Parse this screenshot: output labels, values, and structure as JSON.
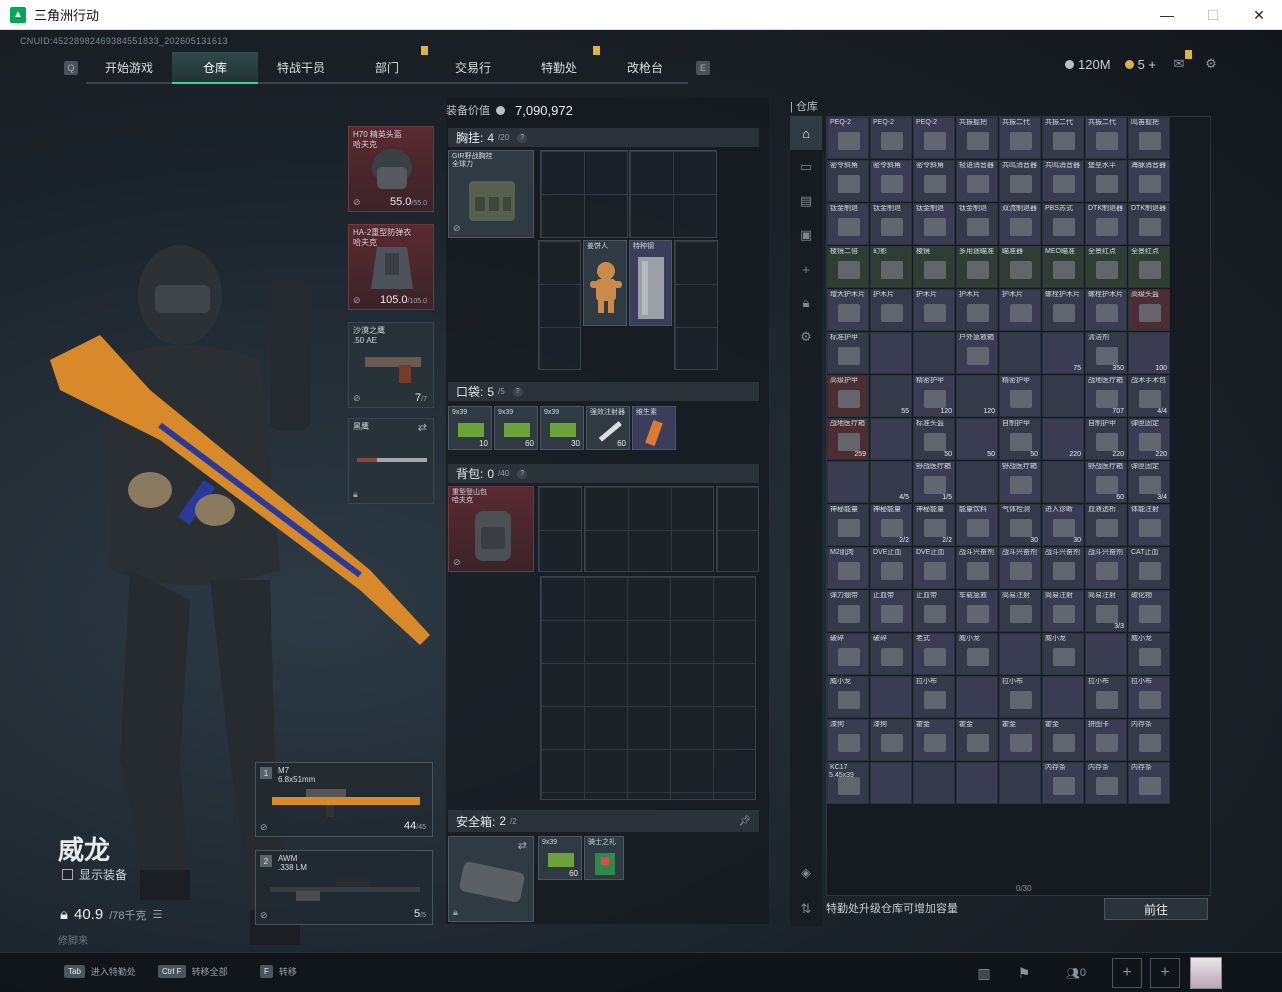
{
  "window": {
    "title": "三角洲行动"
  },
  "uid": "CNUID:4522898246938455183​3_20260513161​3",
  "nav": {
    "tabs": [
      {
        "label": "开始游戏",
        "notif": false
      },
      {
        "label": "仓库",
        "notif": false,
        "active": true
      },
      {
        "label": "特战干员",
        "notif": false
      },
      {
        "label": "部门",
        "notif": true
      },
      {
        "label": "交易行",
        "notif": false
      },
      {
        "label": "特勤处",
        "notif": true
      },
      {
        "label": "改枪台",
        "notif": false
      }
    ],
    "left_key": "Q",
    "right_key": "E"
  },
  "currency": {
    "money": "120M",
    "coins": "5 +"
  },
  "character": {
    "name": "威龙",
    "show_equipment": "显示装备",
    "weight": "40.9",
    "weight_max": "/78千克",
    "repair_hint": "修脚来"
  },
  "equipment": {
    "helmet": {
      "name": "H70 精英头盔",
      "sub": "哈夫克",
      "durability": "55.0",
      "max": "/55.0"
    },
    "armor": {
      "name": "HA-2重型防弹衣",
      "sub": "哈夫克",
      "durability": "105.0",
      "max": "/105.0"
    },
    "pistol": {
      "name": "沙漠之鹰",
      "sub": ".50 AE",
      "ammo": "7",
      "max": "/7"
    },
    "melee": {
      "name": "黑鹰"
    }
  },
  "weapons": [
    {
      "num": "1",
      "name": "M7",
      "caliber": "6.8x51mm",
      "ammo": "44",
      "max": "/45"
    },
    {
      "num": "2",
      "name": "AWM",
      "caliber": ".338 LM",
      "ammo": "5",
      "max": "/5"
    }
  ],
  "loadout": {
    "value_label": "装备价值",
    "value": "7,090,972",
    "chest": {
      "label": "胸挂:",
      "count": "4",
      "max": "/20",
      "item": "GIR野战胸挂",
      "item_sub": "全球力",
      "items": [
        {
          "name": "姜饼人"
        },
        {
          "name": "特种钢"
        }
      ]
    },
    "pockets": {
      "label": "口袋:",
      "count": "5",
      "max": "/5",
      "items": [
        {
          "name": "9x39",
          "count": "10"
        },
        {
          "name": "9x39",
          "count": "60"
        },
        {
          "name": "9x39",
          "count": "30"
        },
        {
          "name": "强效注射器",
          "count": "60"
        },
        {
          "name": "维生素"
        }
      ]
    },
    "backpack": {
      "label": "背包:",
      "count": "0",
      "max": "/40",
      "item": "重型登山包",
      "item_sub": "哈夫克"
    },
    "safe": {
      "label": "安全箱:",
      "count": "2",
      "max": "/2",
      "items": [
        {
          "name": "9x39",
          "count": "60"
        },
        {
          "name": "骑士之礼"
        }
      ]
    }
  },
  "warehouse": {
    "label": "仓库",
    "capacity": "0/30",
    "footer": "特勤处升级仓库可增加容量",
    "go_button": "前往",
    "rows": [
      [
        "PEQ-2",
        "PEQ-2",
        "PEQ-2",
        "共振握把",
        "共振二代",
        "共振二代",
        "共振二代",
        "鸣笛握把"
      ],
      [
        "密令斜角",
        "密令斜角",
        "密令斜角",
        "轻语消音器",
        "共鸣消音器",
        "共鸣消音器",
        "堡垒水平",
        "海豚消音器"
      ],
      [
        "钛金制退",
        "钛金制退",
        "钛金制退",
        "钛金制退",
        "双流制退器",
        "PBS苏式",
        "DTK制退器",
        "DTK制退器"
      ],
      [
        "棱镜二倍",
        "幻影",
        "棱镜",
        "多用途瞄准",
        "瞄准器",
        "MEO瞄准",
        "全景红点",
        "全景红点"
      ],
      [
        "增大护木片",
        "护木片",
        "护木片",
        "护木片",
        "护木片",
        "螺栓护木片",
        "螺栓护木片",
        "高级头盔"
      ],
      [
        "标准护甲",
        "",
        "",
        "户外急救箱",
        "",
        "",
        "清洁剂",
        ""
      ],
      [
        "高级护甲",
        "",
        "精密护甲",
        "",
        "精密护甲",
        "",
        "战地医疗箱",
        "战术手术包"
      ],
      [
        "战地医疗箱",
        "",
        "标准头盔",
        "",
        "自制护甲",
        "",
        "自制护甲",
        "弹匣固定"
      ],
      [
        "",
        "",
        "野战医疗箱",
        "",
        "野战医疗箱",
        "",
        "野战医疗箱",
        "弹匣固定"
      ],
      [
        "神秘能量",
        "神秘能量",
        "神秘能量",
        "能量饮料",
        "气体检测",
        "进入诊断",
        "血液透析",
        "体能注射"
      ],
      [
        "M2肌肉",
        "DVE止血",
        "DVE止血",
        "战斗兴奋剂",
        "战斗兴奋剂",
        "战斗兴奋剂",
        "战斗兴奋剂",
        "CAT止血"
      ],
      [
        "弹力绷带",
        "止血带",
        "止血带",
        "车载急救",
        "简易注射",
        "简易注射",
        "简易注射",
        "碳化物"
      ],
      [
        "破碎",
        "破碎",
        "老式",
        "威小龙",
        "",
        "威小龙",
        "",
        "威小龙"
      ],
      [
        "威小龙",
        "",
        "拉小布",
        "",
        "拉小布",
        "",
        "拉小布",
        "拉小布"
      ],
      [
        "漆狗",
        "漆狗",
        "霍金",
        "霍金",
        "霍金",
        "霍金",
        "拼图卡",
        "内存条"
      ],
      [
        "KC17",
        "",
        "",
        "",
        "",
        "内存条",
        "内存条",
        "内存条"
      ]
    ],
    "counts": {
      "0-5": "75",
      "0-6": "350",
      "0-7": "100",
      "1-1": "55",
      "1-2": "120",
      "1-3": "120",
      "1-6": "707",
      "1-7": "4/4",
      "2-0": "259",
      "2-2": "50",
      "2-3": "50",
      "2-4": "50",
      "2-5": "220",
      "2-6": "220",
      "2-7": "220",
      "3-1": "4/5",
      "3-2": "1/5",
      "3-6": "60",
      "3-7": "3/4",
      "4-1": "2/2",
      "4-2": "2/2",
      "4-4": "30",
      "4-5": "30",
      "6-6": "3/3"
    },
    "weapon_caliber": "5.45x39"
  },
  "hints": [
    {
      "key": "Tab",
      "label": "进入特勤处"
    },
    {
      "key": "Ctrl F",
      "label": "转移全部"
    },
    {
      "key": "F",
      "label": "转移"
    }
  ],
  "social": {
    "friends": "0"
  },
  "colors": {
    "accent": "#37d09a",
    "notif": "#e3b23a",
    "red_slot": "#5a2a30"
  }
}
